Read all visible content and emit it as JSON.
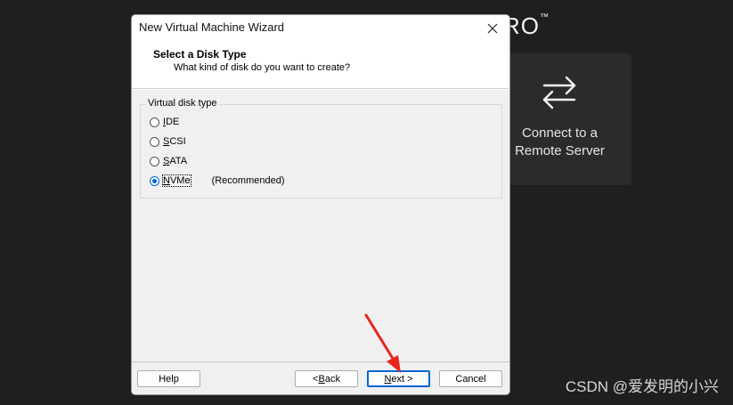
{
  "background": {
    "title": "RO",
    "trademark": "™",
    "tile": {
      "icon": "swap-arrows-icon",
      "label_line1": "Connect to a",
      "label_line2": "Remote Server"
    },
    "watermark": "CSDN @爱发明的小兴"
  },
  "dialog": {
    "title": "New Virtual Machine Wizard",
    "close_icon": "close-icon",
    "header_title": "Select a Disk Type",
    "header_subtitle": "What kind of disk do you want to create?",
    "group_label": "Virtual disk type",
    "options": [
      {
        "key": "I",
        "rest": "DE",
        "checked": false
      },
      {
        "key": "S",
        "rest": "CSI",
        "checked": false
      },
      {
        "key": "S",
        "rest": "ATA",
        "checked": false
      },
      {
        "key": "N",
        "rest": "VMe",
        "checked": true,
        "note": "(Recommended)"
      }
    ],
    "buttons": {
      "help": "Help",
      "back_prefix": "< ",
      "back_key": "B",
      "back_rest": "ack",
      "next_key": "N",
      "next_rest": "ext >",
      "cancel": "Cancel"
    }
  },
  "colors": {
    "accent": "#0064d2",
    "annotation_arrow": "#e8261b"
  }
}
